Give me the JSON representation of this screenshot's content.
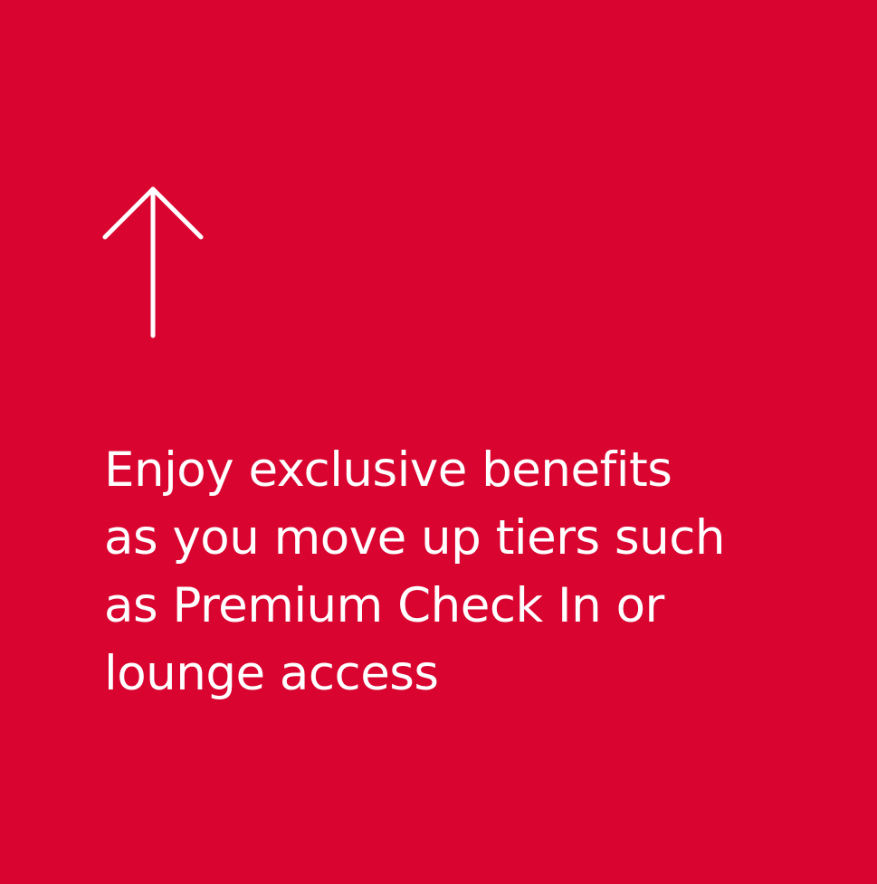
{
  "card": {
    "background_color": "#D90530",
    "foreground_color": "#FFFFFF",
    "icon": "arrow-up-icon",
    "message": "Enjoy exclusive benefits\nas you move up tiers such\nas Premium Check In or\nlounge access"
  }
}
